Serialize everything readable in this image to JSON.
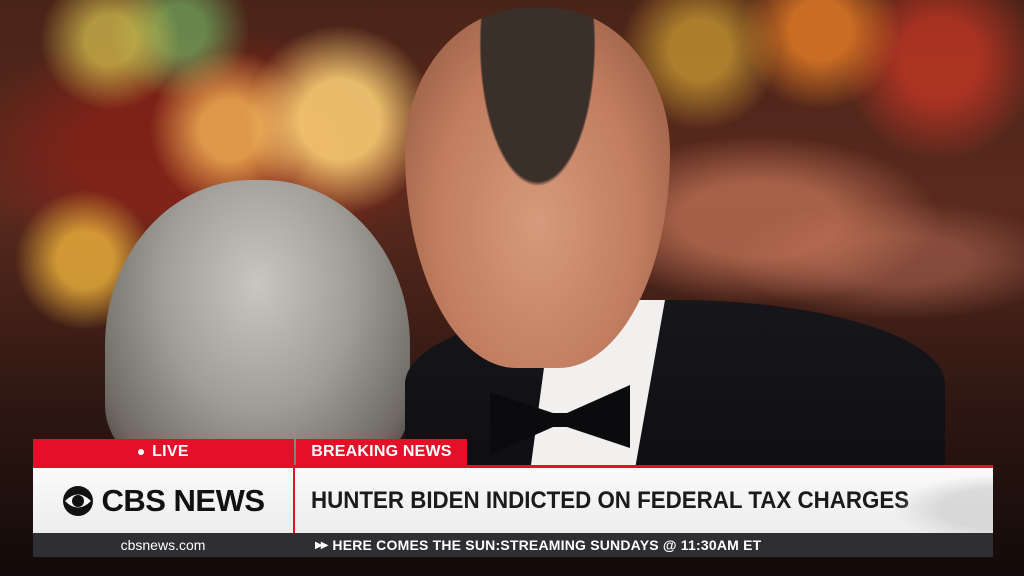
{
  "lower_third": {
    "live_label": "LIVE",
    "breaking_label": "BREAKING NEWS",
    "network_logo": "CBS NEWS",
    "headline": "HUNTER BIDEN INDICTED ON FEDERAL TAX CHARGES",
    "site_url": "cbsnews.com",
    "ticker_text": "HERE COMES THE SUN:STREAMING SUNDAYS @ 11:30AM ET"
  },
  "icons": {
    "live": "live-dot-icon",
    "logo": "cbs-eye-icon",
    "ticker": "play-arrows-icon"
  },
  "colors": {
    "accent_red": "#e4102a",
    "bar_white": "#f4f4f4",
    "ticker_dark": "#2f2f33"
  }
}
